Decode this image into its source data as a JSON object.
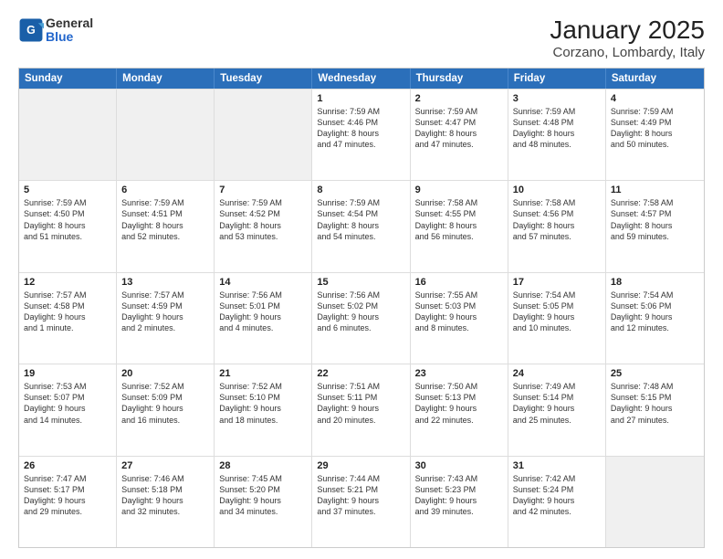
{
  "logo": {
    "general": "General",
    "blue": "Blue"
  },
  "title": "January 2025",
  "subtitle": "Corzano, Lombardy, Italy",
  "days": [
    "Sunday",
    "Monday",
    "Tuesday",
    "Wednesday",
    "Thursday",
    "Friday",
    "Saturday"
  ],
  "weeks": [
    [
      {
        "day": "",
        "info": ""
      },
      {
        "day": "",
        "info": ""
      },
      {
        "day": "",
        "info": ""
      },
      {
        "day": "1",
        "info": "Sunrise: 7:59 AM\nSunset: 4:46 PM\nDaylight: 8 hours\nand 47 minutes."
      },
      {
        "day": "2",
        "info": "Sunrise: 7:59 AM\nSunset: 4:47 PM\nDaylight: 8 hours\nand 47 minutes."
      },
      {
        "day": "3",
        "info": "Sunrise: 7:59 AM\nSunset: 4:48 PM\nDaylight: 8 hours\nand 48 minutes."
      },
      {
        "day": "4",
        "info": "Sunrise: 7:59 AM\nSunset: 4:49 PM\nDaylight: 8 hours\nand 50 minutes."
      }
    ],
    [
      {
        "day": "5",
        "info": "Sunrise: 7:59 AM\nSunset: 4:50 PM\nDaylight: 8 hours\nand 51 minutes."
      },
      {
        "day": "6",
        "info": "Sunrise: 7:59 AM\nSunset: 4:51 PM\nDaylight: 8 hours\nand 52 minutes."
      },
      {
        "day": "7",
        "info": "Sunrise: 7:59 AM\nSunset: 4:52 PM\nDaylight: 8 hours\nand 53 minutes."
      },
      {
        "day": "8",
        "info": "Sunrise: 7:59 AM\nSunset: 4:54 PM\nDaylight: 8 hours\nand 54 minutes."
      },
      {
        "day": "9",
        "info": "Sunrise: 7:58 AM\nSunset: 4:55 PM\nDaylight: 8 hours\nand 56 minutes."
      },
      {
        "day": "10",
        "info": "Sunrise: 7:58 AM\nSunset: 4:56 PM\nDaylight: 8 hours\nand 57 minutes."
      },
      {
        "day": "11",
        "info": "Sunrise: 7:58 AM\nSunset: 4:57 PM\nDaylight: 8 hours\nand 59 minutes."
      }
    ],
    [
      {
        "day": "12",
        "info": "Sunrise: 7:57 AM\nSunset: 4:58 PM\nDaylight: 9 hours\nand 1 minute."
      },
      {
        "day": "13",
        "info": "Sunrise: 7:57 AM\nSunset: 4:59 PM\nDaylight: 9 hours\nand 2 minutes."
      },
      {
        "day": "14",
        "info": "Sunrise: 7:56 AM\nSunset: 5:01 PM\nDaylight: 9 hours\nand 4 minutes."
      },
      {
        "day": "15",
        "info": "Sunrise: 7:56 AM\nSunset: 5:02 PM\nDaylight: 9 hours\nand 6 minutes."
      },
      {
        "day": "16",
        "info": "Sunrise: 7:55 AM\nSunset: 5:03 PM\nDaylight: 9 hours\nand 8 minutes."
      },
      {
        "day": "17",
        "info": "Sunrise: 7:54 AM\nSunset: 5:05 PM\nDaylight: 9 hours\nand 10 minutes."
      },
      {
        "day": "18",
        "info": "Sunrise: 7:54 AM\nSunset: 5:06 PM\nDaylight: 9 hours\nand 12 minutes."
      }
    ],
    [
      {
        "day": "19",
        "info": "Sunrise: 7:53 AM\nSunset: 5:07 PM\nDaylight: 9 hours\nand 14 minutes."
      },
      {
        "day": "20",
        "info": "Sunrise: 7:52 AM\nSunset: 5:09 PM\nDaylight: 9 hours\nand 16 minutes."
      },
      {
        "day": "21",
        "info": "Sunrise: 7:52 AM\nSunset: 5:10 PM\nDaylight: 9 hours\nand 18 minutes."
      },
      {
        "day": "22",
        "info": "Sunrise: 7:51 AM\nSunset: 5:11 PM\nDaylight: 9 hours\nand 20 minutes."
      },
      {
        "day": "23",
        "info": "Sunrise: 7:50 AM\nSunset: 5:13 PM\nDaylight: 9 hours\nand 22 minutes."
      },
      {
        "day": "24",
        "info": "Sunrise: 7:49 AM\nSunset: 5:14 PM\nDaylight: 9 hours\nand 25 minutes."
      },
      {
        "day": "25",
        "info": "Sunrise: 7:48 AM\nSunset: 5:15 PM\nDaylight: 9 hours\nand 27 minutes."
      }
    ],
    [
      {
        "day": "26",
        "info": "Sunrise: 7:47 AM\nSunset: 5:17 PM\nDaylight: 9 hours\nand 29 minutes."
      },
      {
        "day": "27",
        "info": "Sunrise: 7:46 AM\nSunset: 5:18 PM\nDaylight: 9 hours\nand 32 minutes."
      },
      {
        "day": "28",
        "info": "Sunrise: 7:45 AM\nSunset: 5:20 PM\nDaylight: 9 hours\nand 34 minutes."
      },
      {
        "day": "29",
        "info": "Sunrise: 7:44 AM\nSunset: 5:21 PM\nDaylight: 9 hours\nand 37 minutes."
      },
      {
        "day": "30",
        "info": "Sunrise: 7:43 AM\nSunset: 5:23 PM\nDaylight: 9 hours\nand 39 minutes."
      },
      {
        "day": "31",
        "info": "Sunrise: 7:42 AM\nSunset: 5:24 PM\nDaylight: 9 hours\nand 42 minutes."
      },
      {
        "day": "",
        "info": ""
      }
    ]
  ]
}
